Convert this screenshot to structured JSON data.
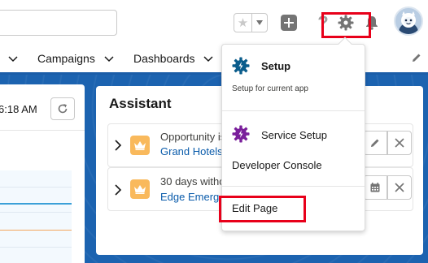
{
  "header": {
    "favorites_star": "★",
    "help_glyph": "?"
  },
  "nav": {
    "items": [
      "Campaigns",
      "Dashboards"
    ]
  },
  "left_panel": {
    "time_text": "6:18 AM"
  },
  "assistant": {
    "title": "Assistant",
    "items": [
      {
        "text": "Opportunity is",
        "link": "Grand Hotels"
      },
      {
        "text": "30 days witho",
        "link": "Edge Emerg"
      }
    ]
  },
  "setup_menu": {
    "setup_label": "Setup",
    "setup_sub": "Setup for current app",
    "service_setup_label": "Service Setup",
    "developer_console_label": "Developer Console",
    "edit_page_label": "Edit Page"
  },
  "colors": {
    "brand_blue": "#1c63b0",
    "highlight_red": "#e8001a",
    "setup_icon_blue": "#0b5d8c",
    "service_icon_purple": "#7a1f9b",
    "crown_orange": "#f9b95c"
  }
}
